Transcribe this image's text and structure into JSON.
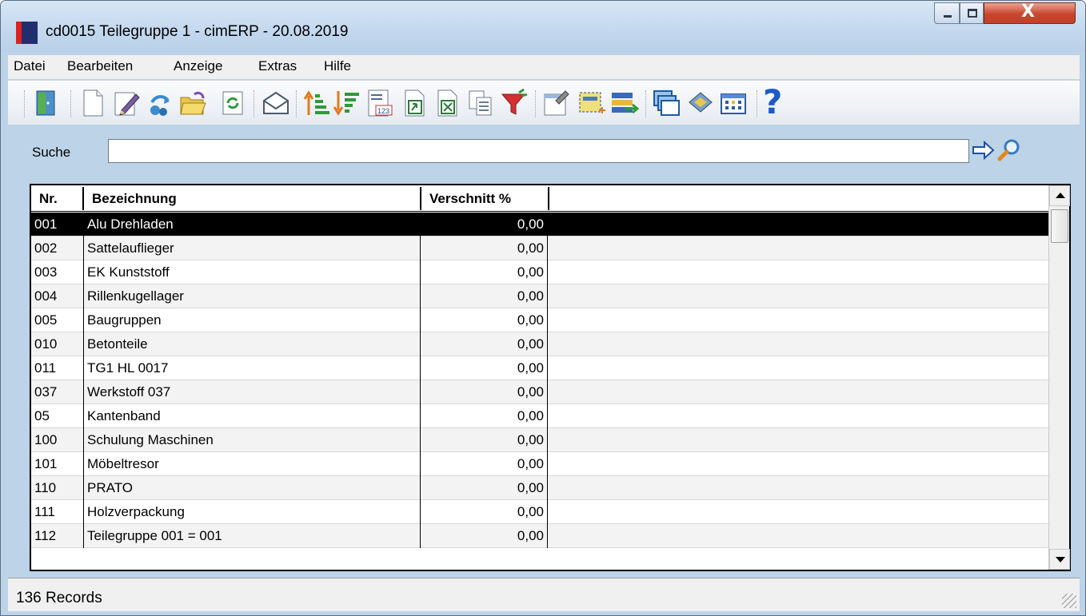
{
  "window": {
    "title": "cd0015 Teilegruppe 1 - cimERP - 20.08.2019",
    "close_glyph": "X"
  },
  "menu": {
    "items": [
      {
        "label": "Datei"
      },
      {
        "label": "Bearbeiten"
      },
      {
        "label": "Anzeige"
      },
      {
        "label": "Extras"
      },
      {
        "label": "Hilfe"
      }
    ]
  },
  "toolbar": {
    "icons": [
      "exit-door-icon",
      "new-document-icon",
      "edit-pencil-icon",
      "copy-icon",
      "open-folder-icon",
      "refresh-icon",
      "mail-icon",
      "sort-ascending-icon",
      "sort-descending-icon",
      "numeric-filter-icon",
      "export-icon",
      "excel-export-icon",
      "clipboard-icon",
      "filter-funnel-icon",
      "properties-icon",
      "select-area-icon",
      "transfer-icon",
      "windows-icon",
      "book-icon",
      "calendar-grid-icon",
      "help-icon"
    ],
    "help_label": "?"
  },
  "search": {
    "label": "Suche",
    "value": "",
    "placeholder": ""
  },
  "grid": {
    "columns": [
      "Nr.",
      "Bezeichnung",
      "Verschnitt %",
      ""
    ],
    "rows": [
      {
        "nr": "001",
        "bezeichnung": "Alu Drehladen",
        "verschnitt": "0,00"
      },
      {
        "nr": "002",
        "bezeichnung": "Sattelauflieger",
        "verschnitt": "0,00"
      },
      {
        "nr": "003",
        "bezeichnung": "EK Kunststoff",
        "verschnitt": "0,00"
      },
      {
        "nr": "004",
        "bezeichnung": "Rillenkugellager",
        "verschnitt": "0,00"
      },
      {
        "nr": "005",
        "bezeichnung": "Baugruppen",
        "verschnitt": "0,00"
      },
      {
        "nr": "010",
        "bezeichnung": "Betonteile",
        "verschnitt": "0,00"
      },
      {
        "nr": "011",
        "bezeichnung": "TG1 HL 0017",
        "verschnitt": "0,00"
      },
      {
        "nr": "037",
        "bezeichnung": "Werkstoff 037",
        "verschnitt": "0,00"
      },
      {
        "nr": "05",
        "bezeichnung": "Kantenband",
        "verschnitt": "0,00"
      },
      {
        "nr": "100",
        "bezeichnung": "Schulung Maschinen",
        "verschnitt": "0,00"
      },
      {
        "nr": "101",
        "bezeichnung": "Möbeltresor",
        "verschnitt": "0,00"
      },
      {
        "nr": "110",
        "bezeichnung": "PRATO",
        "verschnitt": "0,00"
      },
      {
        "nr": "111",
        "bezeichnung": "Holzverpackung",
        "verschnitt": "0,00"
      },
      {
        "nr": "112",
        "bezeichnung": "Teilegruppe 001 = 001",
        "verschnitt": "0,00"
      }
    ],
    "selected_index": 0
  },
  "status": {
    "text": "136 Records"
  },
  "colors": {
    "window_bg": "#bcd3e8",
    "selected_row": "#000000",
    "close_button": "#c8452c"
  }
}
